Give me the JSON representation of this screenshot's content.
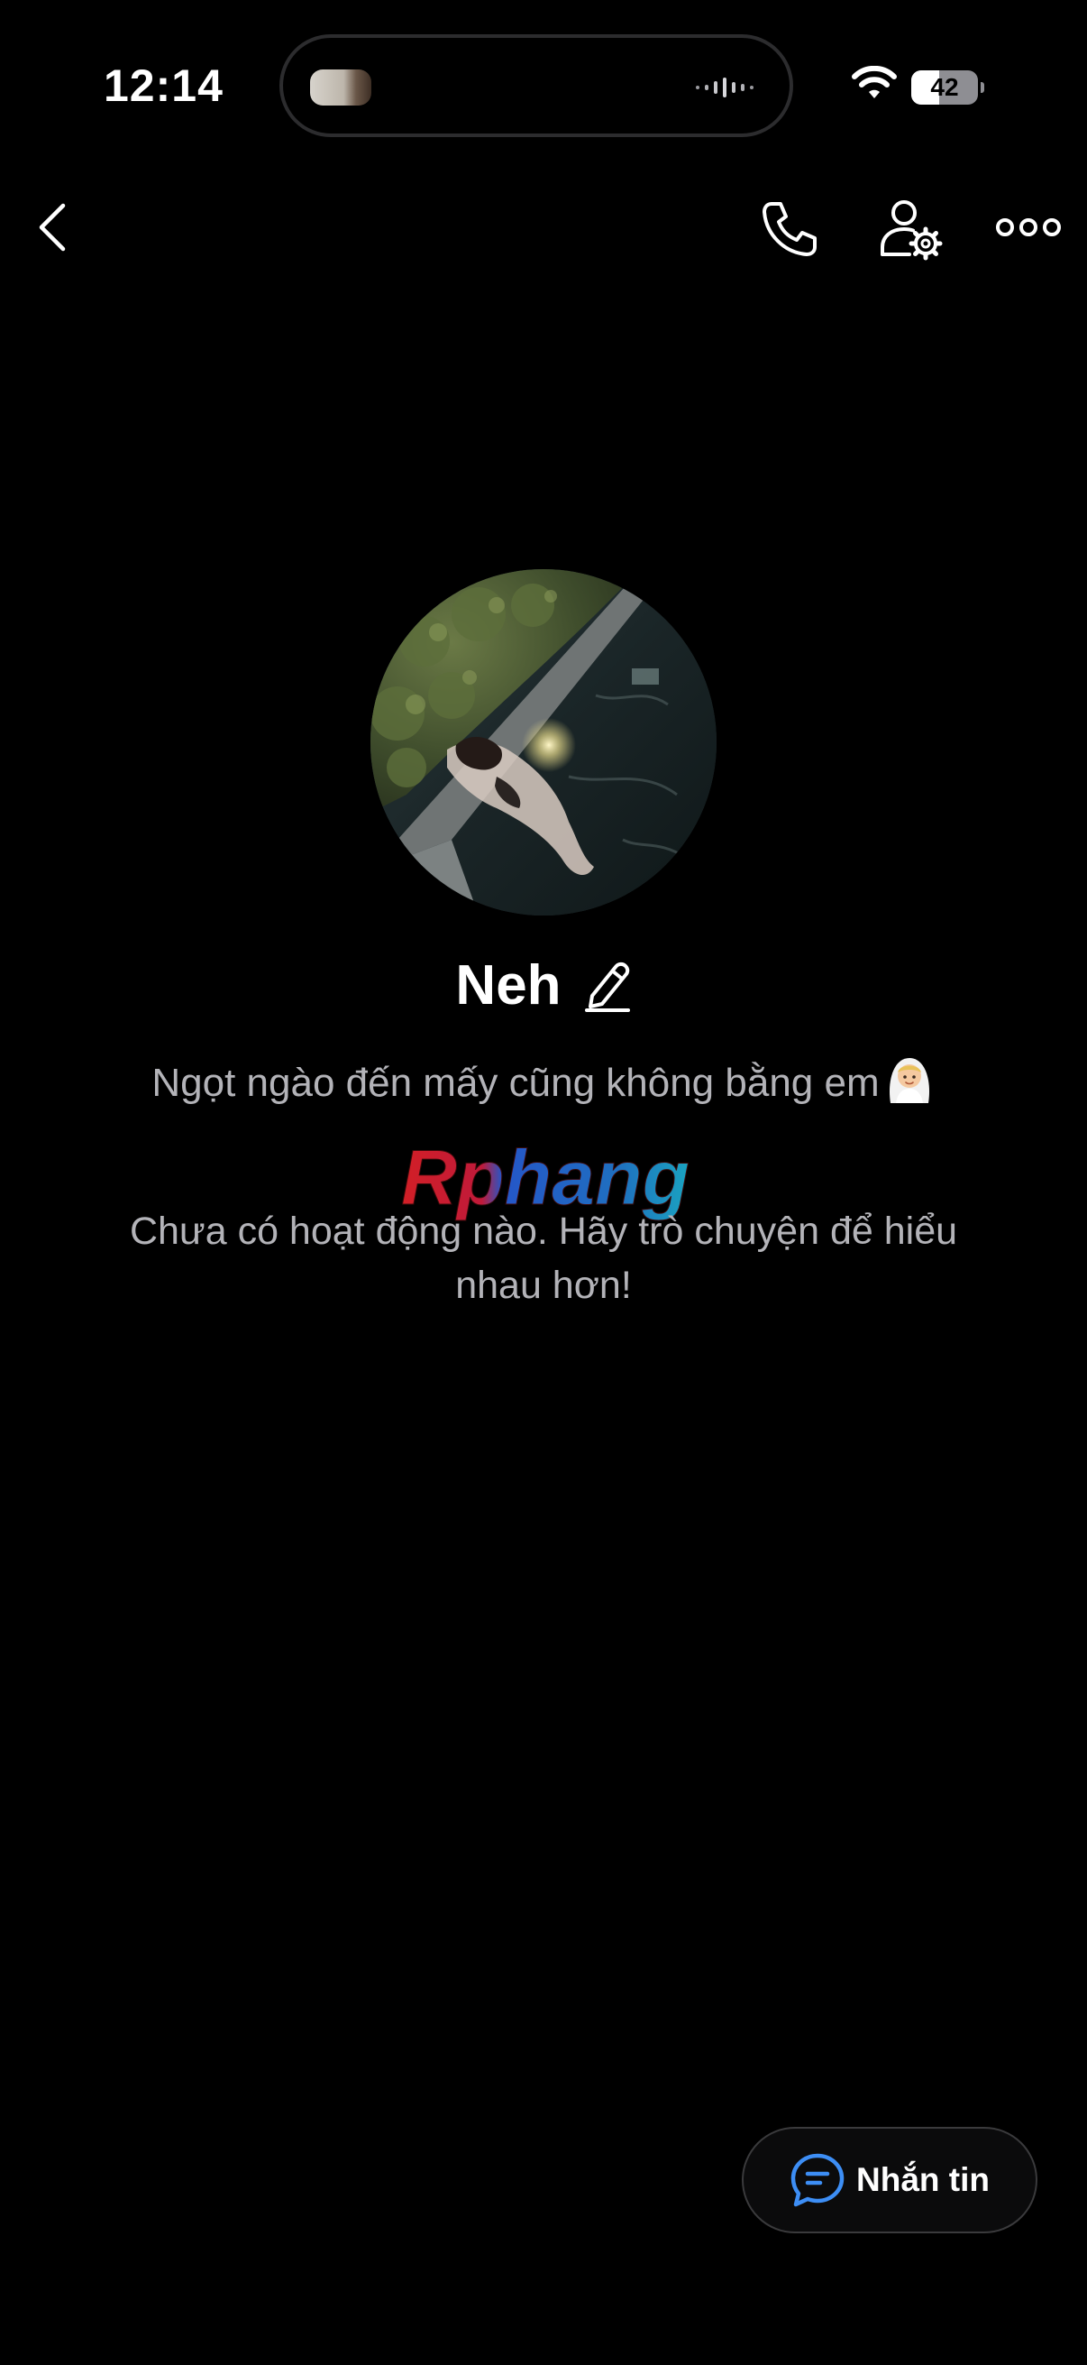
{
  "status_bar": {
    "time": "12:14",
    "battery_level": "42",
    "battery_fraction": 0.42
  },
  "top_bar": {
    "icons": [
      "chevron-left-icon",
      "phone-icon",
      "user-settings-icon",
      "more-icon"
    ]
  },
  "profile": {
    "name": "Neh",
    "bio": "Ngọt ngào đến mấy cũng không bằng em",
    "bio_emoji": "bride-with-veil-emoji",
    "empty_activity_text": "Chưa có hoạt động nào. Hãy trò chuyện để hiểu nhau hơn!"
  },
  "watermark": {
    "text": "Rphang"
  },
  "actions": {
    "message_label": "Nhắn tin"
  },
  "colors": {
    "background": "#000000",
    "secondary_text": "#b3b3b8",
    "accent_blue": "#3d8ef5"
  }
}
